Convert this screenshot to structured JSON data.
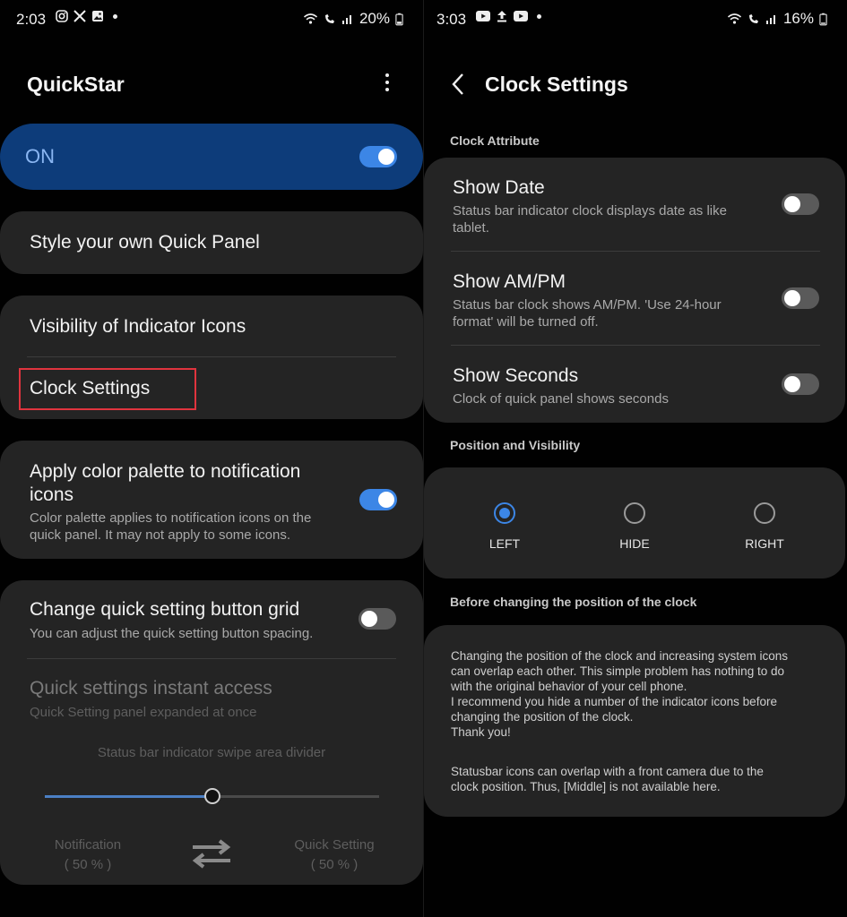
{
  "left": {
    "status": {
      "time": "2:03",
      "battery": "20%",
      "app_icons": [
        "instagram-icon",
        "x-icon",
        "gallery-icon"
      ],
      "sys_icons": [
        "wifi-icon",
        "wifi-calling-icon",
        "signal-icon",
        "battery-icon"
      ]
    },
    "title": "QuickStar",
    "master_toggle": {
      "label": "ON",
      "state": "on"
    },
    "style_panel": "Style your own Quick Panel",
    "visibility_icons": "Visibility of Indicator Icons",
    "clock_settings": "Clock Settings",
    "color_palette": {
      "title_line1": "Apply color palette to notification",
      "title_line2": "icons",
      "sub_line1": "Color palette applies to notification icons on the",
      "sub_line2": "quick panel. It may not apply to some icons.",
      "state": "on"
    },
    "button_grid": {
      "title": "Change quick setting button grid",
      "sub": "You can adjust the quick setting button spacing.",
      "state": "off"
    },
    "instant_access": {
      "title": "Quick settings instant access",
      "sub": "Quick Setting panel expanded at once"
    },
    "swipe_divider": {
      "label": "Status bar indicator swipe area divider",
      "value_fraction": 0.5,
      "left_label": "Notification",
      "left_value": "( 50 % )",
      "right_label": "Quick Setting",
      "right_value": "( 50 % )"
    }
  },
  "right": {
    "status": {
      "time": "3:03",
      "battery": "16%",
      "app_icons": [
        "youtube-icon",
        "upload-icon",
        "youtube-icon"
      ],
      "sys_icons": [
        "wifi-icon",
        "wifi-calling-icon",
        "signal-icon",
        "battery-icon"
      ]
    },
    "title": "Clock Settings",
    "clock_attribute_header": "Clock Attribute",
    "show_date": {
      "title": "Show Date",
      "sub_line1": "Status bar indicator clock displays date as like",
      "sub_line2": "tablet.",
      "state": "off"
    },
    "show_ampm": {
      "title": "Show AM/PM",
      "sub_line1": "Status bar clock shows AM/PM. 'Use 24-hour",
      "sub_line2": "format' will be turned off.",
      "state": "off"
    },
    "show_seconds": {
      "title": "Show Seconds",
      "sub": "Clock of quick panel shows seconds",
      "state": "off"
    },
    "position_header": "Position and Visibility",
    "position_options": [
      "LEFT",
      "HIDE",
      "RIGHT"
    ],
    "position_selected": "LEFT",
    "before_header": "Before changing the position of the clock",
    "info_paragraph1": "Changing the position of the clock and increasing system icons\ncan overlap each other. This simple problem has nothing to do\nwith the original behavior of your cell phone.\n I recommend you hide a number of the indicator icons before\nchanging the position of the clock.\n Thank you!",
    "info_paragraph2": "Statusbar icons can overlap with a front camera due to the\nclock position. Thus, [Middle] is not available here."
  },
  "colors": {
    "accent": "#3c86e6",
    "on_banner": "#0d3c7a",
    "card": "#242424",
    "highlight": "#e0343e"
  }
}
